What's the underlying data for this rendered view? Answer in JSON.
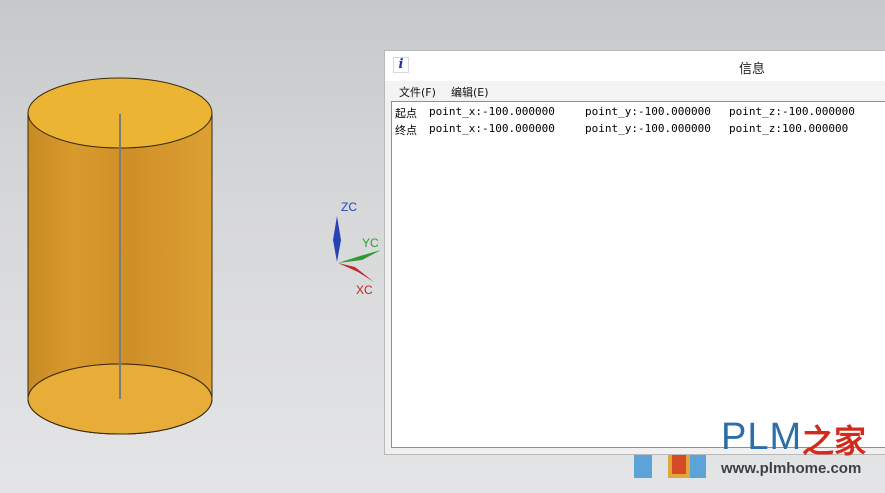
{
  "window": {
    "title": "信息",
    "icon": "info-icon",
    "icon_glyph": "i"
  },
  "menu": {
    "file": "文件(F)",
    "edit": "编辑(E)"
  },
  "lines": [
    {
      "label": "起点",
      "x": "point_x:-100.000000",
      "y": "point_y:-100.000000",
      "z": "point_z:-100.000000"
    },
    {
      "label": "终点",
      "x": "point_x:-100.000000",
      "y": "point_y:-100.000000",
      "z": "point_z:100.000000"
    }
  ],
  "triad": {
    "zc": "ZC",
    "yc": "YC",
    "xc": "XC",
    "colors": {
      "z": "#2743b8",
      "y": "#2f9a2f",
      "x": "#c02828"
    }
  },
  "model": {
    "body_color": "#e0a030",
    "top_color": "#eab232"
  },
  "watermark": {
    "brand": "PLM",
    "brand_cn": "之家",
    "url": "www.plmhome.com"
  }
}
